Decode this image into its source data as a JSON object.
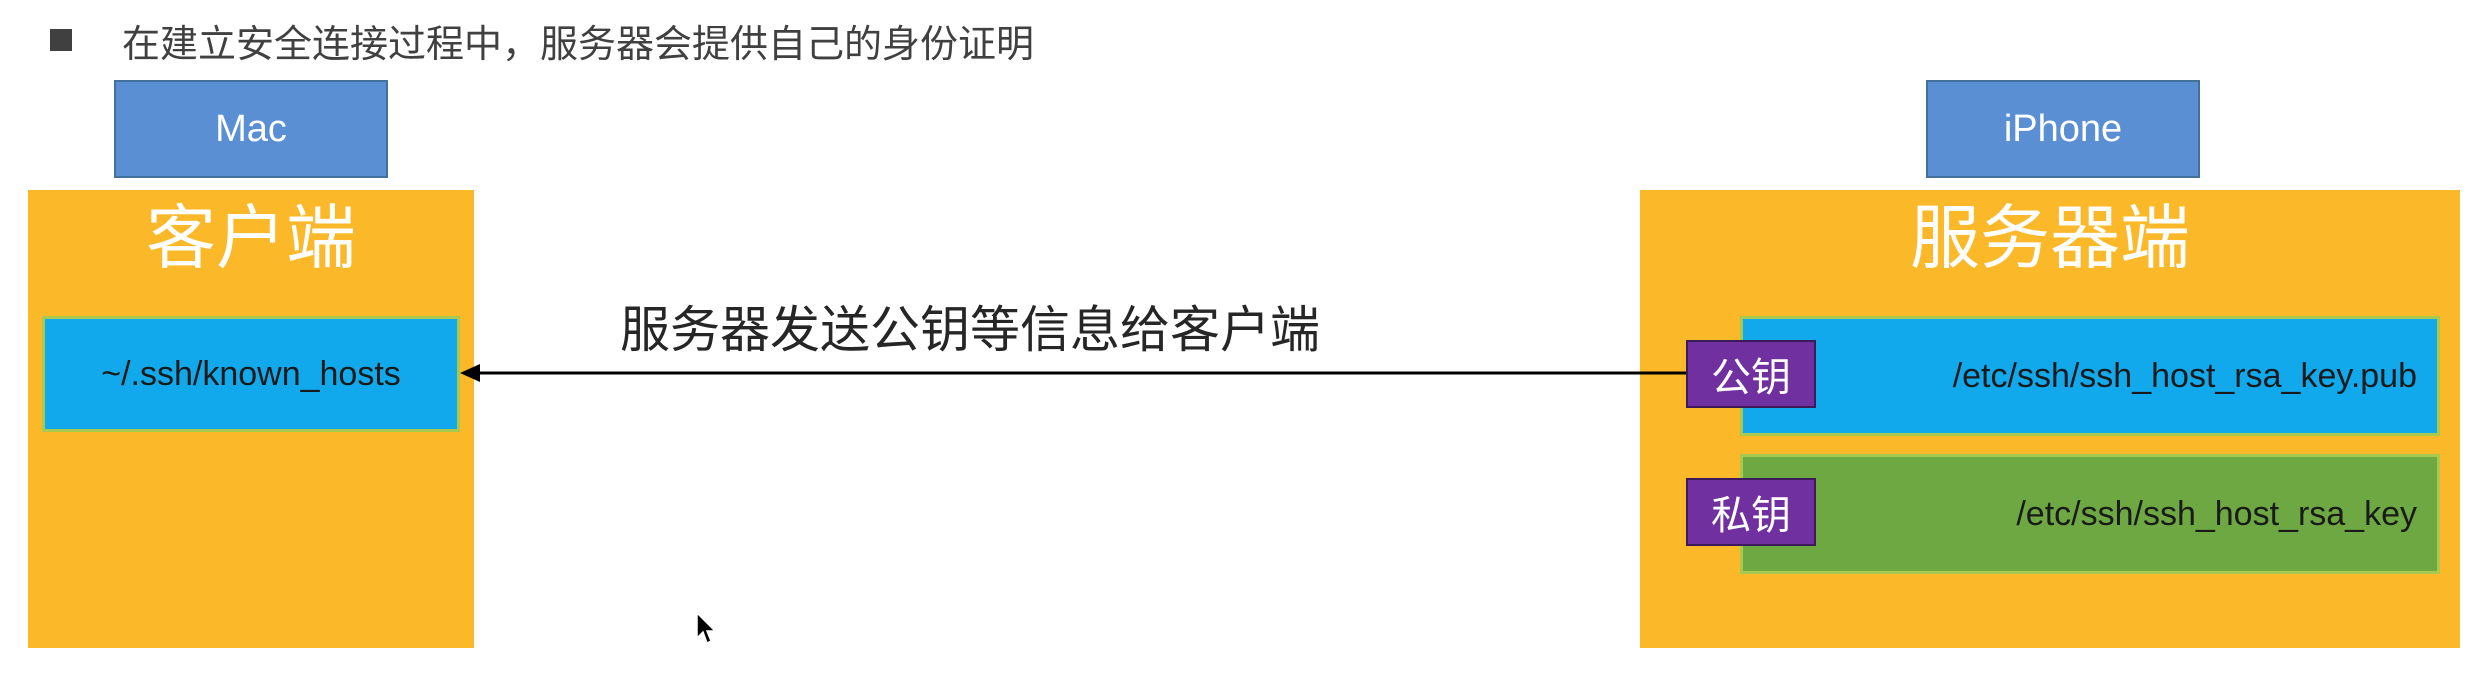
{
  "header": {
    "text": "在建立安全连接过程中，服务器会提供自己的身份证明"
  },
  "client": {
    "device": "Mac",
    "title": "客户端",
    "file": "~/.ssh/known_hosts"
  },
  "server": {
    "device": "iPhone",
    "title": "服务器端",
    "public_key_label": "公钥",
    "public_key_file": "/etc/ssh/ssh_host_rsa_key.pub",
    "private_key_label": "私钥",
    "private_key_file": "/etc/ssh/ssh_host_rsa_key"
  },
  "arrow": {
    "label": "服务器发送公钥等信息给客户端"
  },
  "colors": {
    "panel": "#fbb829",
    "device_label": "#5b8fd3",
    "public_box": "#12a9ec",
    "private_box": "#6ea842",
    "key_badge": "#7030a0"
  }
}
